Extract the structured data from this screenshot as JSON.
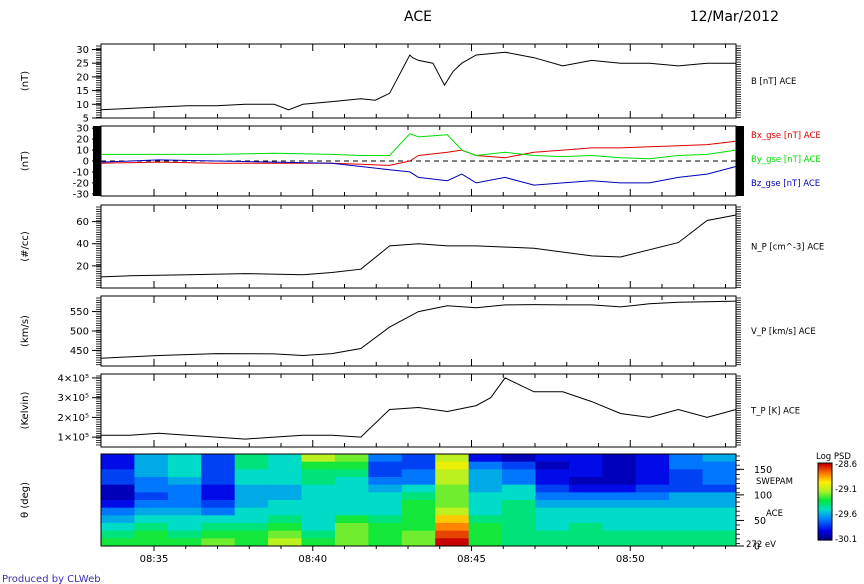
{
  "header": {
    "title": "ACE",
    "date": "12/Mar/2012"
  },
  "footer": {
    "credit": "Produced by CLWeb"
  },
  "colors": {
    "black": "#000000",
    "bx": "#dd0000",
    "by": "#00dd00",
    "bz": "#0000bb"
  },
  "chart_data": [
    {
      "type": "line",
      "panel": "B",
      "ylabel": "(nT)",
      "ylim": [
        5,
        32
      ],
      "yticks": [
        "5",
        "10",
        "15",
        "20",
        "25",
        "30"
      ],
      "ytick_values": [
        5,
        10,
        15,
        20,
        25,
        30
      ],
      "x": [
        0,
        1,
        2,
        3,
        4,
        5,
        6,
        6.5,
        7,
        8,
        9,
        9.5,
        10,
        10.7,
        10.8,
        11,
        11.5,
        11.9,
        12.2,
        12.5,
        13,
        14,
        15,
        16,
        17,
        18,
        19,
        20,
        21,
        22
      ],
      "series": [
        {
          "name": "B [nT] ACE",
          "color": "#000000",
          "values": [
            8,
            8.5,
            9,
            9.5,
            9.5,
            10,
            10,
            8,
            10,
            11,
            12,
            11.5,
            14,
            28,
            27,
            26,
            25,
            17,
            22,
            25,
            28,
            29,
            27,
            24,
            26,
            25,
            25,
            24,
            25,
            25
          ]
        }
      ]
    },
    {
      "type": "line",
      "panel": "Bgse",
      "ylabel": "(nT)",
      "ylim": [
        -32,
        32
      ],
      "yticks": [
        "-30",
        "-20",
        "-10",
        "0",
        "10",
        "20",
        "30"
      ],
      "ytick_values": [
        -30,
        -20,
        -10,
        0,
        10,
        20,
        30
      ],
      "x": [
        0,
        2,
        4,
        6,
        8,
        9,
        10,
        10.7,
        11,
        12,
        12.5,
        13,
        14,
        15,
        16,
        17,
        18,
        19,
        20,
        21,
        22
      ],
      "series": [
        {
          "name": "Bx_gse [nT] ACE",
          "color": "#dd0000",
          "values": [
            -2,
            -1,
            -2,
            -2,
            -2,
            -3,
            -4,
            0,
            5,
            8,
            10,
            5,
            3,
            8,
            10,
            12,
            12,
            13,
            14,
            15,
            18
          ]
        },
        {
          "name": "By_gse [nT] ACE",
          "color": "#00dd00",
          "values": [
            6,
            6,
            6,
            7,
            6,
            5,
            5,
            25,
            22,
            24,
            10,
            5,
            8,
            5,
            4,
            5,
            3,
            2,
            5,
            6,
            10
          ]
        },
        {
          "name": "Bz_gse [nT] ACE",
          "color": "#0000bb",
          "values": [
            -1,
            1,
            0,
            -1,
            -2,
            -5,
            -8,
            -10,
            -15,
            -18,
            -12,
            -20,
            -15,
            -22,
            -20,
            -18,
            -20,
            -20,
            -15,
            -12,
            -5
          ]
        }
      ]
    },
    {
      "type": "line",
      "panel": "NP",
      "ylabel": "(#/cc)",
      "ylim": [
        0,
        75
      ],
      "yticks": [
        "20",
        "40",
        "60"
      ],
      "ytick_values": [
        20,
        40,
        60
      ],
      "x": [
        0,
        1,
        3,
        5,
        7,
        8,
        9,
        10,
        11,
        12,
        13,
        15,
        17,
        18,
        20,
        21,
        22
      ],
      "series": [
        {
          "name": "N_P [cm^-3] ACE",
          "color": "#000000",
          "values": [
            10,
            11,
            12,
            13,
            12,
            14,
            17,
            38,
            40,
            38,
            38,
            36,
            29,
            28,
            41,
            61,
            66
          ]
        }
      ]
    },
    {
      "type": "line",
      "panel": "VP",
      "ylabel": "(km/s)",
      "ylim": [
        410,
        590
      ],
      "yticks": [
        "450",
        "500",
        "550"
      ],
      "ytick_values": [
        450,
        500,
        550
      ],
      "x": [
        0,
        2,
        4,
        6,
        7,
        8,
        9,
        10,
        11,
        12,
        13,
        14,
        15,
        16,
        17,
        18,
        19,
        20,
        21,
        22
      ],
      "series": [
        {
          "name": "V_P [km/s] ACE",
          "color": "#000000",
          "values": [
            430,
            437,
            442,
            441,
            437,
            442,
            455,
            510,
            550,
            565,
            560,
            567,
            568,
            567,
            567,
            562,
            570,
            574,
            575,
            577
          ]
        }
      ]
    },
    {
      "type": "line",
      "panel": "TP",
      "ylabel": "(Kelvin)",
      "ylim": [
        0.5,
        4.2
      ],
      "yticks": [
        "1×10⁵",
        "2×10⁵",
        "3×10⁵",
        "4×10⁵"
      ],
      "ytick_values": [
        1,
        2,
        3,
        4
      ],
      "x": [
        0,
        1,
        2,
        3,
        4,
        5,
        6,
        7,
        8,
        9,
        10,
        11,
        12,
        13,
        13.5,
        14,
        15,
        16,
        17,
        18,
        19,
        20,
        21,
        22
      ],
      "series": [
        {
          "name": "T_P [K] ACE",
          "color": "#000000",
          "values": [
            1.1,
            1.1,
            1.2,
            1.1,
            1.0,
            0.9,
            1.0,
            1.1,
            1.1,
            1.0,
            2.4,
            2.5,
            2.3,
            2.6,
            3.0,
            4.0,
            3.3,
            3.3,
            2.8,
            2.2,
            2.0,
            2.4,
            2.0,
            2.4
          ]
        }
      ]
    },
    {
      "type": "heatmap",
      "panel": "SWEPAM",
      "ylabel": "θ (deg)",
      "yticks": [
        "150",
        "100",
        "50",
        "0"
      ],
      "ytick_values": [
        150,
        100,
        50,
        0
      ],
      "ylim": [
        0,
        180
      ],
      "right_labels": [
        "SWEPAM",
        "ACE",
        "272 eV"
      ],
      "xticks": [
        "08:35",
        "08:40",
        "08:45",
        "08:50"
      ],
      "colorbar": {
        "title": "Log PSD",
        "max": "-28.6",
        "mid1": "-29.1",
        "mid2": "-29.6",
        "min": "-30.1",
        "vmin": -30.1,
        "vmax": -28.6
      },
      "ncols": 19,
      "nrows": 12,
      "values": [
        [
          -29.9,
          -29.6,
          -29.5,
          -29.8,
          -29.4,
          -29.5,
          -29.1,
          -29.2,
          -29.7,
          -29.8,
          -29.1,
          -29.9,
          -30.0,
          -29.9,
          -29.9,
          -30.0,
          -29.9,
          -29.7,
          -29.6
        ],
        [
          -29.9,
          -29.6,
          -29.5,
          -29.8,
          -29.4,
          -29.5,
          -29.3,
          -29.3,
          -29.8,
          -29.8,
          -29.0,
          -29.7,
          -29.8,
          -30.0,
          -29.9,
          -30.0,
          -29.9,
          -29.7,
          -29.7
        ],
        [
          -29.8,
          -29.6,
          -29.5,
          -29.8,
          -29.5,
          -29.5,
          -29.4,
          -29.4,
          -29.8,
          -29.7,
          -29.1,
          -29.6,
          -29.7,
          -29.9,
          -29.9,
          -30.0,
          -29.9,
          -29.8,
          -29.7
        ],
        [
          -29.8,
          -29.7,
          -29.6,
          -29.8,
          -29.5,
          -29.5,
          -29.4,
          -29.5,
          -29.7,
          -29.7,
          -29.1,
          -29.6,
          -29.7,
          -29.9,
          -30.0,
          -30.0,
          -29.9,
          -29.8,
          -29.7
        ],
        [
          -30.0,
          -29.7,
          -29.7,
          -29.9,
          -29.6,
          -29.6,
          -29.5,
          -29.5,
          -29.6,
          -29.5,
          -29.2,
          -29.6,
          -29.5,
          -29.8,
          -29.9,
          -29.9,
          -29.8,
          -29.8,
          -29.8
        ],
        [
          -30.0,
          -29.8,
          -29.7,
          -29.9,
          -29.6,
          -29.6,
          -29.5,
          -29.5,
          -29.5,
          -29.4,
          -29.2,
          -29.5,
          -29.5,
          -29.7,
          -29.7,
          -29.7,
          -29.7,
          -29.6,
          -29.6
        ],
        [
          -29.9,
          -29.7,
          -29.7,
          -29.8,
          -29.6,
          -29.5,
          -29.5,
          -29.5,
          -29.5,
          -29.3,
          -29.2,
          -29.5,
          -29.4,
          -29.6,
          -29.6,
          -29.6,
          -29.6,
          -29.6,
          -29.6
        ],
        [
          -29.7,
          -29.6,
          -29.6,
          -29.7,
          -29.5,
          -29.5,
          -29.5,
          -29.5,
          -29.5,
          -29.3,
          -29.1,
          -29.5,
          -29.4,
          -29.5,
          -29.5,
          -29.5,
          -29.5,
          -29.5,
          -29.5
        ],
        [
          -29.6,
          -29.5,
          -29.5,
          -29.5,
          -29.5,
          -29.4,
          -29.5,
          -29.3,
          -29.4,
          -29.3,
          -28.9,
          -29.4,
          -29.4,
          -29.5,
          -29.5,
          -29.5,
          -29.5,
          -29.5,
          -29.5
        ],
        [
          -29.5,
          -29.4,
          -29.5,
          -29.4,
          -29.4,
          -29.3,
          -29.5,
          -29.2,
          -29.3,
          -29.3,
          -28.8,
          -29.3,
          -29.4,
          -29.5,
          -29.4,
          -29.5,
          -29.5,
          -29.5,
          -29.5
        ],
        [
          -29.4,
          -29.3,
          -29.4,
          -29.3,
          -29.3,
          -29.2,
          -29.4,
          -29.2,
          -29.3,
          -29.2,
          -28.7,
          -29.3,
          -29.4,
          -29.4,
          -29.4,
          -29.4,
          -29.4,
          -29.4,
          -29.4
        ],
        [
          -29.3,
          -29.3,
          -29.3,
          -29.2,
          -29.3,
          -29.1,
          -29.3,
          -29.2,
          -29.3,
          -29.2,
          -28.6,
          -29.3,
          -29.4,
          -29.4,
          -29.4,
          -29.4,
          -29.4,
          -29.4,
          -29.4
        ]
      ]
    }
  ]
}
